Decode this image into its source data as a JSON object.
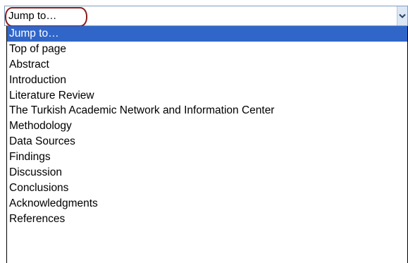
{
  "select": {
    "value": "Jump to…"
  },
  "options": [
    {
      "label": "Jump to…",
      "selected": true
    },
    {
      "label": "Top of page",
      "selected": false
    },
    {
      "label": "Abstract",
      "selected": false
    },
    {
      "label": "Introduction",
      "selected": false
    },
    {
      "label": "Literature Review",
      "selected": false
    },
    {
      "label": "The Turkish Academic Network and Information Center",
      "selected": false
    },
    {
      "label": "Methodology",
      "selected": false
    },
    {
      "label": "Data Sources",
      "selected": false
    },
    {
      "label": "Findings",
      "selected": false
    },
    {
      "label": "Discussion",
      "selected": false
    },
    {
      "label": "Conclusions",
      "selected": false
    },
    {
      "label": "Acknowledgments",
      "selected": false
    },
    {
      "label": "References",
      "selected": false
    }
  ],
  "colors": {
    "selected_bg": "#3166c9",
    "selected_fg": "#ffffff",
    "highlight_ring": "#8b1c1c"
  },
  "icons": {
    "dropdown": "chevron-down-icon"
  }
}
